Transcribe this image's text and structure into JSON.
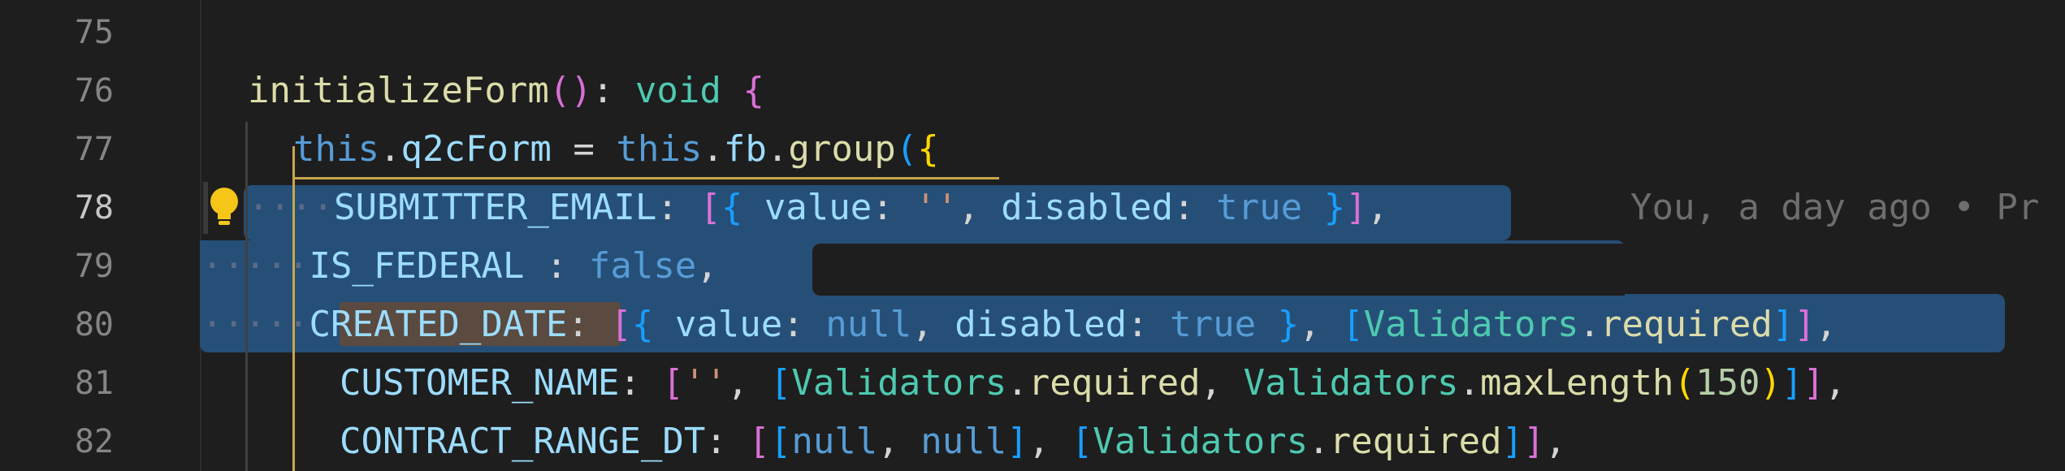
{
  "editor": {
    "blame": "You, a day ago • Pr",
    "lines": [
      {
        "number": "75",
        "active": false
      },
      {
        "number": "76",
        "active": false
      },
      {
        "number": "77",
        "active": false
      },
      {
        "number": "78",
        "active": true
      },
      {
        "number": "79",
        "active": false
      },
      {
        "number": "80",
        "active": false
      },
      {
        "number": "81",
        "active": false
      },
      {
        "number": "82",
        "active": false
      }
    ],
    "tokens": {
      "initializeForm": "initializeForm",
      "void": "void",
      "this": "this",
      "q2cForm": "q2cForm",
      "fb": "fb",
      "group": "group",
      "SUBMITTER_EMAIL": "SUBMITTER_EMAIL",
      "IS_FEDERAL": "IS_FEDERAL",
      "CREATED_DATE": "CREATED_DATE",
      "CUSTOMER_NAME": "CUSTOMER_NAME",
      "CONTRACT_RANGE_DT": "CONTRACT_RANGE_DT",
      "value": "value",
      "disabled": "disabled",
      "true": "true",
      "false": "false",
      "null": "null",
      "empty_string": "''",
      "Validators": "Validators",
      "required": "required",
      "maxLength": "maxLength",
      "num150": "150"
    }
  },
  "colors": {
    "background": "#1e1e1e",
    "selection": "#264f78",
    "keyword": "#569cd6",
    "function": "#dcdcaa",
    "string": "#ce9178",
    "property": "#9cdcfe",
    "type": "#4ec9b0"
  },
  "icons": {
    "lightbulb": "lightbulb-icon"
  }
}
